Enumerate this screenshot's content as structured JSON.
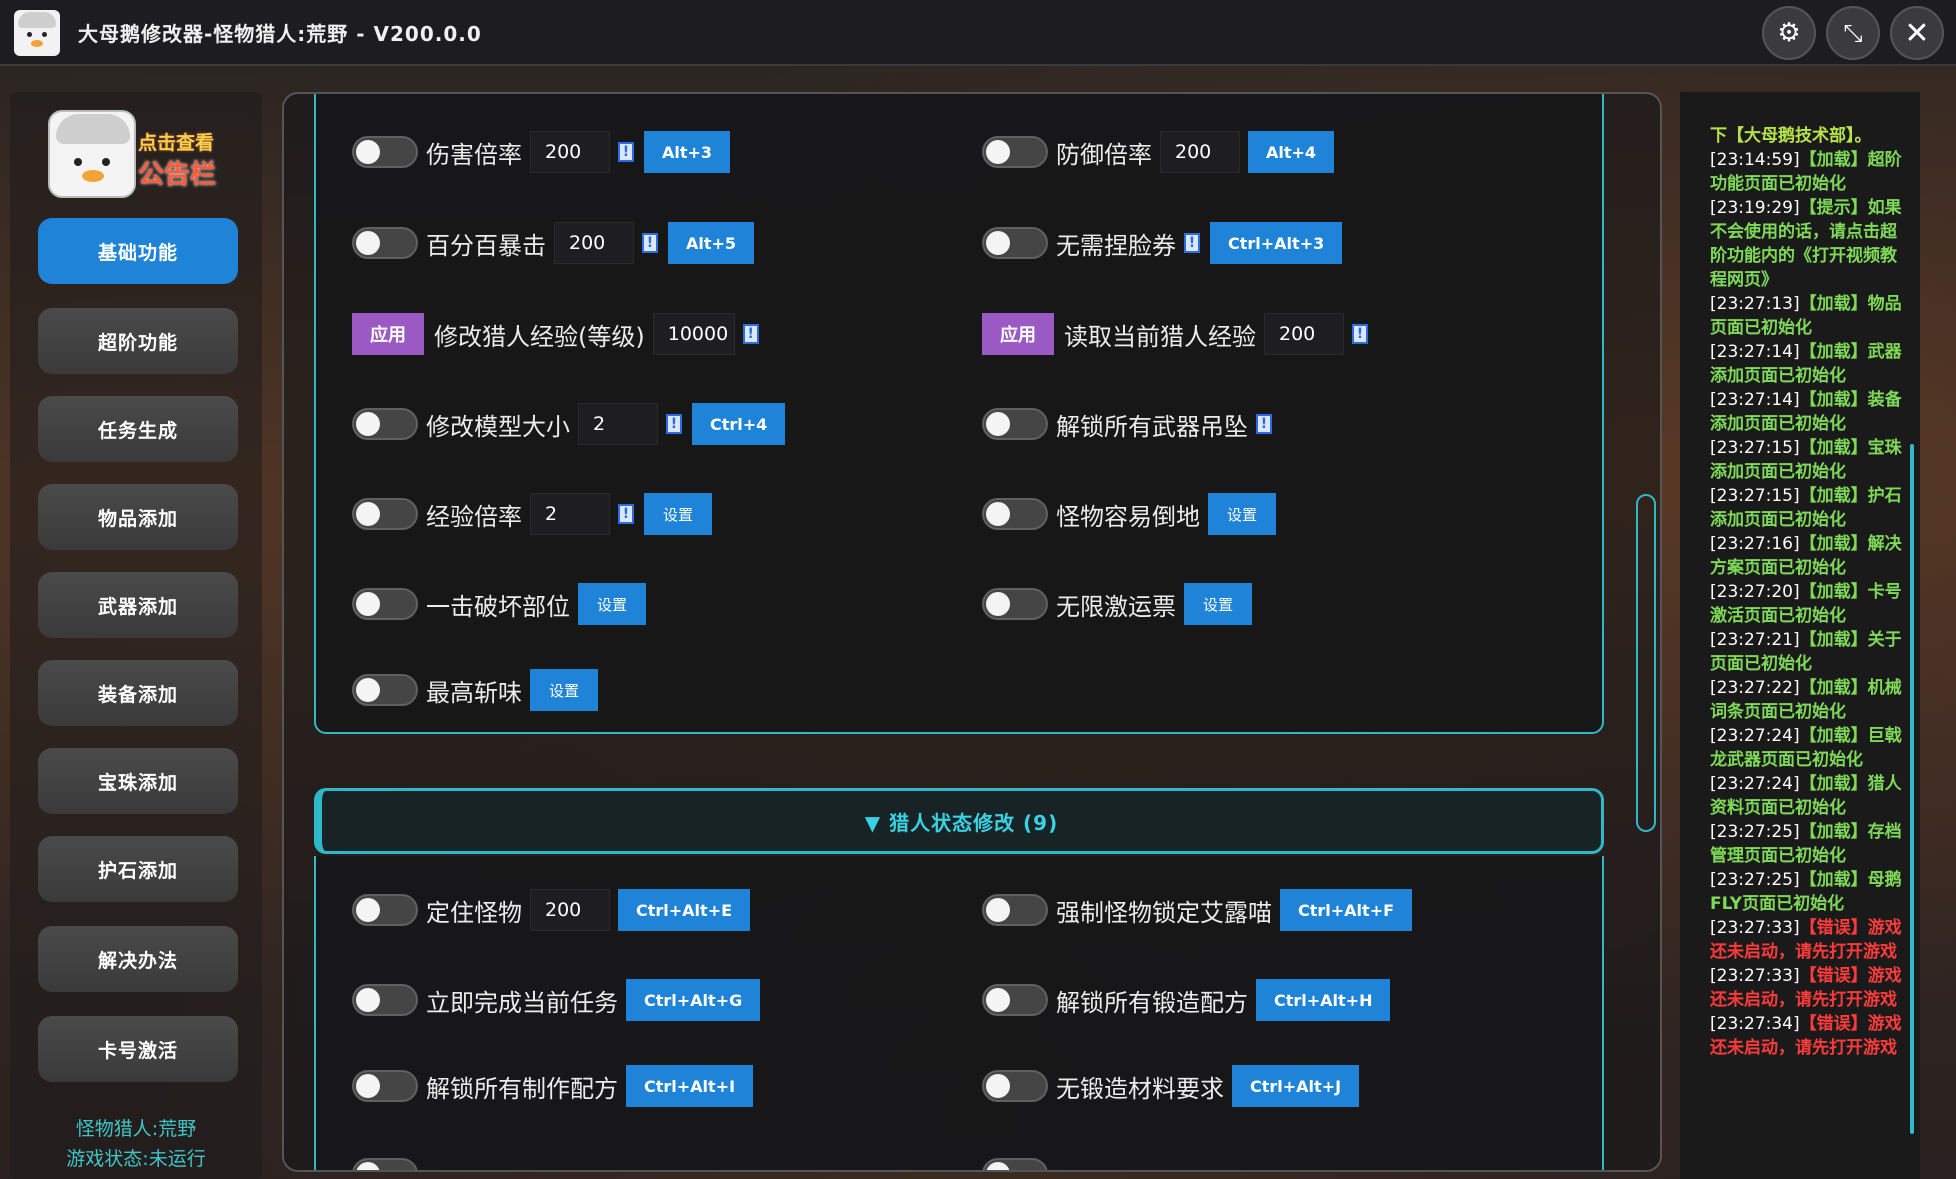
{
  "window": {
    "title": "大母鹅修改器-怪物猎人:荒野 - V200.0.0",
    "buttons": {
      "settings_icon": "gear-icon",
      "shrink_icon": "shrink-icon",
      "close_icon": "close-icon"
    }
  },
  "sidebar": {
    "notice_line1": "点击查看",
    "notice_line2": "公告栏",
    "items": [
      {
        "label": "基础功能",
        "active": true
      },
      {
        "label": "超阶功能"
      },
      {
        "label": "任务生成"
      },
      {
        "label": "物品添加"
      },
      {
        "label": "武器添加"
      },
      {
        "label": "装备添加"
      },
      {
        "label": "宝珠添加"
      },
      {
        "label": "护石添加"
      },
      {
        "label": "解决办法"
      },
      {
        "label": "卡号激活"
      }
    ],
    "footer_game": "怪物猎人:荒野",
    "footer_status": "游戏状态:未运行"
  },
  "basic": {
    "damage": {
      "label": "伤害倍率",
      "value": "200",
      "hotkey": "Alt+3"
    },
    "defense": {
      "label": "防御倍率",
      "value": "200",
      "hotkey": "Alt+4"
    },
    "crit": {
      "label": "百分百暴击",
      "value": "200",
      "hotkey": "Alt+5"
    },
    "nofacecoupon": {
      "label": "无需捏脸券",
      "hotkey": "Ctrl+Alt+3"
    },
    "exp_mod": {
      "button": "应用",
      "label": "修改猎人经验(等级)",
      "value": "10000"
    },
    "exp_read": {
      "button": "应用",
      "label": "读取当前猎人经验",
      "value": "200"
    },
    "model_size": {
      "label": "修改模型大小",
      "value": "2",
      "hotkey": "Ctrl+4"
    },
    "unlock_pendants": {
      "label": "解锁所有武器吊坠"
    },
    "exp_rate": {
      "label": "经验倍率",
      "value": "2",
      "button": "设置"
    },
    "easy_knockdown": {
      "label": "怪物容易倒地",
      "button": "设置"
    },
    "break_parts": {
      "label": "一击破坏部位",
      "button": "设置"
    },
    "infinite_vouchers": {
      "label": "无限激运票",
      "button": "设置"
    },
    "max_sharpness": {
      "label": "最高斩味",
      "button": "设置"
    }
  },
  "hunter_section": {
    "title": "▼ 猎人状态修改 (9)",
    "freeze": {
      "label": "定住怪物",
      "value": "200",
      "hotkey": "Ctrl+Alt+E"
    },
    "lock_palico": {
      "label": "强制怪物锁定艾露喵",
      "hotkey": "Ctrl+Alt+F"
    },
    "finish_quest": {
      "label": "立即完成当前任务",
      "hotkey": "Ctrl+Alt+G"
    },
    "unlock_forge": {
      "label": "解锁所有锻造配方",
      "hotkey": "Ctrl+Alt+H"
    },
    "unlock_craft": {
      "label": "解锁所有制作配方",
      "hotkey": "Ctrl+Alt+I"
    },
    "no_forge_mat": {
      "label": "无锻造材料要求",
      "hotkey": "Ctrl+Alt+J"
    }
  },
  "log": [
    {
      "ts": "",
      "text": "下【大母鹅技术部】。",
      "color": "#b6e24a"
    },
    {
      "ts": "[23:14:59]",
      "text": "【加载】超阶功能页面已初始化",
      "color": "#7ed957"
    },
    {
      "ts": "[23:19:29]",
      "text": "【提示】如果不会使用的话，请点击超阶功能内的《打开视频教程网页》",
      "color": "#7ed957"
    },
    {
      "ts": "[23:27:13]",
      "text": "【加载】物品页面已初始化",
      "color": "#7ed957"
    },
    {
      "ts": "[23:27:14]",
      "text": "【加载】武器添加页面已初始化",
      "color": "#7ed957"
    },
    {
      "ts": "[23:27:14]",
      "text": "【加载】装备添加页面已初始化",
      "color": "#7ed957"
    },
    {
      "ts": "[23:27:15]",
      "text": "【加载】宝珠添加页面已初始化",
      "color": "#7ed957"
    },
    {
      "ts": "[23:27:15]",
      "text": "【加载】护石添加页面已初始化",
      "color": "#7ed957"
    },
    {
      "ts": "[23:27:16]",
      "text": "【加载】解决方案页面已初始化",
      "color": "#7ed957"
    },
    {
      "ts": "[23:27:20]",
      "text": "【加载】卡号激活页面已初始化",
      "color": "#7ed957"
    },
    {
      "ts": "[23:27:21]",
      "text": "【加载】关于页面已初始化",
      "color": "#7ed957"
    },
    {
      "ts": "[23:27:22]",
      "text": "【加载】机械词条页面已初始化",
      "color": "#7ed957"
    },
    {
      "ts": "[23:27:24]",
      "text": "【加载】巨戟龙武器页面已初始化",
      "color": "#7ed957"
    },
    {
      "ts": "[23:27:24]",
      "text": "【加载】猎人资料页面已初始化",
      "color": "#7ed957"
    },
    {
      "ts": "[23:27:25]",
      "text": "【加载】存档管理页面已初始化",
      "color": "#7ed957"
    },
    {
      "ts": "[23:27:25]",
      "text": "【加载】母鹅FLY页面已初始化",
      "color": "#7ed957"
    },
    {
      "ts": "[23:27:33]",
      "text": "【错误】游戏还未启动，请先打开游戏",
      "color": "#ff3b3b"
    },
    {
      "ts": "[23:27:33]",
      "text": "【错误】游戏还未启动，请先打开游戏",
      "color": "#ff3b3b"
    },
    {
      "ts": "[23:27:34]",
      "text": "【错误】游戏还未启动，请先打开游戏",
      "color": "#ff3b3b"
    }
  ]
}
